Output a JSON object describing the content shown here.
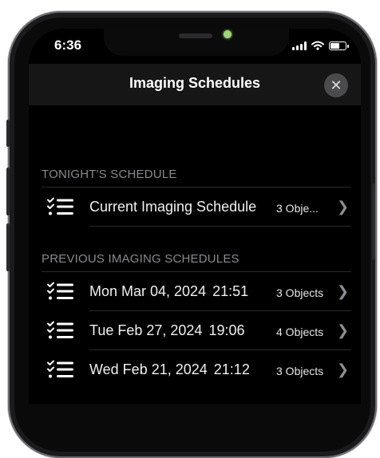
{
  "status_bar": {
    "time": "6:36",
    "battery_level": 0.7
  },
  "nav": {
    "title": "Imaging Schedules",
    "close_glyph": "✕"
  },
  "tonight": {
    "header": "TONIGHT'S SCHEDULE",
    "items": [
      {
        "title": "Current Imaging Schedule",
        "count": "3 Obje..."
      }
    ]
  },
  "previous": {
    "header": "PREVIOUS IMAGING SCHEDULES",
    "items": [
      {
        "date": "Mon Mar 04, 2024",
        "time": "21:51",
        "count": "3 Objects"
      },
      {
        "date": "Tue Feb 27, 2024",
        "time": "19:06",
        "count": "4 Objects"
      },
      {
        "date": "Wed Feb 21, 2024",
        "time": "21:12",
        "count": "3 Objects"
      }
    ]
  },
  "icons": {
    "row_icon": "checklist-icon",
    "chevron": "chevron-right-icon"
  },
  "colors": {
    "background": "#000000",
    "nav_bar": "#161616",
    "section_text": "#8a8a8e"
  }
}
